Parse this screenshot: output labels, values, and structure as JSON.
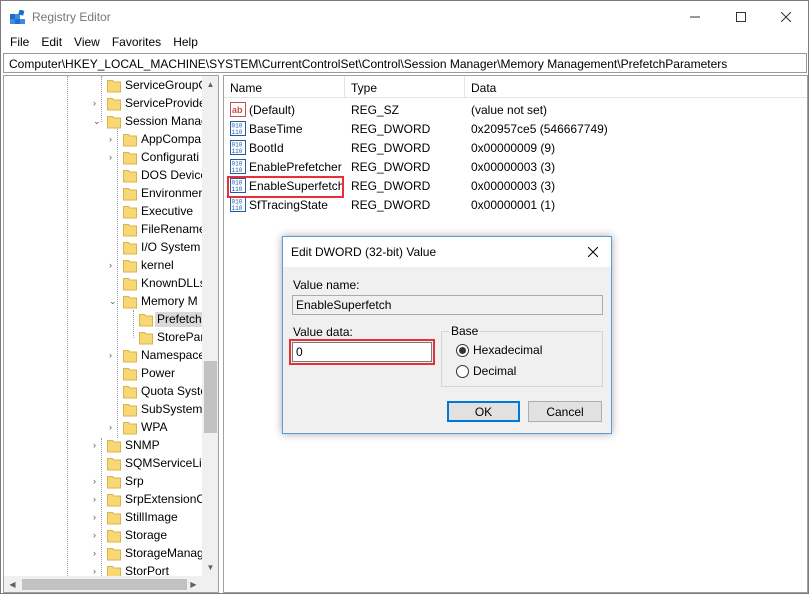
{
  "window": {
    "title": "Registry Editor",
    "controls": {
      "minimize": "—",
      "maximize": "☐",
      "close": "✕"
    }
  },
  "menu": [
    "File",
    "Edit",
    "View",
    "Favorites",
    "Help"
  ],
  "address": "Computer\\HKEY_LOCAL_MACHINE\\SYSTEM\\CurrentControlSet\\Control\\Session Manager\\Memory Management\\PrefetchParameters",
  "tree": {
    "items": [
      {
        "label": "ServiceGroupC",
        "expander": ""
      },
      {
        "label": "ServiceProvide",
        "expander": "›"
      },
      {
        "label": "Session Manag",
        "expander": "⌄"
      },
      {
        "label": "AppCompa",
        "expander": "›"
      },
      {
        "label": "Configurati",
        "expander": "›"
      },
      {
        "label": "DOS Device",
        "expander": ""
      },
      {
        "label": "Environmer",
        "expander": ""
      },
      {
        "label": "Executive",
        "expander": ""
      },
      {
        "label": "FileRename",
        "expander": ""
      },
      {
        "label": "I/O System",
        "expander": ""
      },
      {
        "label": "kernel",
        "expander": "›"
      },
      {
        "label": "KnownDLLs",
        "expander": ""
      },
      {
        "label": "Memory M",
        "expander": "⌄"
      },
      {
        "label": "Prefetch",
        "expander": ""
      },
      {
        "label": "StorePar",
        "expander": ""
      },
      {
        "label": "Namespace",
        "expander": "›"
      },
      {
        "label": "Power",
        "expander": ""
      },
      {
        "label": "Quota Syste",
        "expander": ""
      },
      {
        "label": "SubSystem",
        "expander": ""
      },
      {
        "label": "WPA",
        "expander": "›"
      },
      {
        "label": "SNMP",
        "expander": "›"
      },
      {
        "label": "SQMServiceLis",
        "expander": ""
      },
      {
        "label": "Srp",
        "expander": "›"
      },
      {
        "label": "SrpExtensionC",
        "expander": "›"
      },
      {
        "label": "StillImage",
        "expander": "›"
      },
      {
        "label": "Storage",
        "expander": "›"
      },
      {
        "label": "StorageManag",
        "expander": "›"
      },
      {
        "label": "StorPort",
        "expander": "›"
      }
    ],
    "scroll_up": "▲",
    "scroll_down": "▼",
    "scroll_left": "◀",
    "scroll_right": "▶"
  },
  "list": {
    "columns": [
      "Name",
      "Type",
      "Data"
    ],
    "rows": [
      {
        "name": "(Default)",
        "type": "REG_SZ",
        "data": "(value not set)",
        "icon": "string-value-icon"
      },
      {
        "name": "BaseTime",
        "type": "REG_DWORD",
        "data": "0x20957ce5 (546667749)",
        "icon": "binary-value-icon"
      },
      {
        "name": "BootId",
        "type": "REG_DWORD",
        "data": "0x00000009 (9)",
        "icon": "binary-value-icon"
      },
      {
        "name": "EnablePrefetcher",
        "type": "REG_DWORD",
        "data": "0x00000003 (3)",
        "icon": "binary-value-icon"
      },
      {
        "name": "EnableSuperfetch",
        "type": "REG_DWORD",
        "data": "0x00000003 (3)",
        "icon": "binary-value-icon"
      },
      {
        "name": "SfTracingState",
        "type": "REG_DWORD",
        "data": "0x00000001 (1)",
        "icon": "binary-value-icon"
      }
    ]
  },
  "dialog": {
    "title": "Edit DWORD (32-bit) Value",
    "close": "✕",
    "value_name_label": "Value name:",
    "value_name": "EnableSuperfetch",
    "value_data_label": "Value data:",
    "value_data": "0",
    "base_label": "Base",
    "hex_label": "Hexadecimal",
    "dec_label": "Decimal",
    "base_selected": "Hexadecimal",
    "ok": "OK",
    "cancel": "Cancel"
  },
  "colors": {
    "highlight": "#e5303c",
    "dialog_border": "#5d9bd5",
    "folder": "#f8d775"
  }
}
